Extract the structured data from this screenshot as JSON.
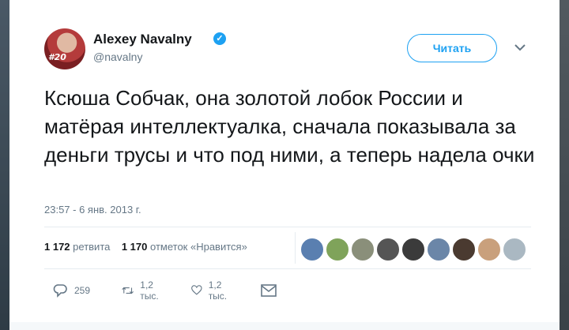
{
  "user": {
    "name": "Alexey Navalny",
    "handle": "@navalny",
    "avatar_tag": "#20",
    "verified_icon": "verified-badge-icon"
  },
  "header": {
    "follow_label": "Читать",
    "more_icon": "chevron-down-icon"
  },
  "tweet": {
    "text": "Ксюша Собчак, она золотой лобок России и матёрая интеллектуалка, сначала показывала за деньги трусы и что под ними, а теперь надела очки",
    "timestamp": "23:57 - 6 янв. 2013 г."
  },
  "stats": {
    "retweets_count": "1 172",
    "retweets_label": "ретвита",
    "likes_count": "1 170",
    "likes_label": "отметок «Нравится»",
    "liker_avatar_colors": [
      "#5a7fb0",
      "#7fa35a",
      "#8a8f7a",
      "#555555",
      "#3b3b3b",
      "#6b86a8",
      "#4a3a30",
      "#c9a07c",
      "#aab8c2"
    ]
  },
  "actions": {
    "reply_count": "259",
    "retweet_count": "1,2 тыс.",
    "like_count": "1,2 тыс.",
    "reply_icon": "reply-icon",
    "retweet_icon": "retweet-icon",
    "like_icon": "heart-icon",
    "dm_icon": "envelope-icon"
  },
  "colors": {
    "accent": "#1da1f2",
    "text": "#14171a",
    "muted": "#657786"
  }
}
